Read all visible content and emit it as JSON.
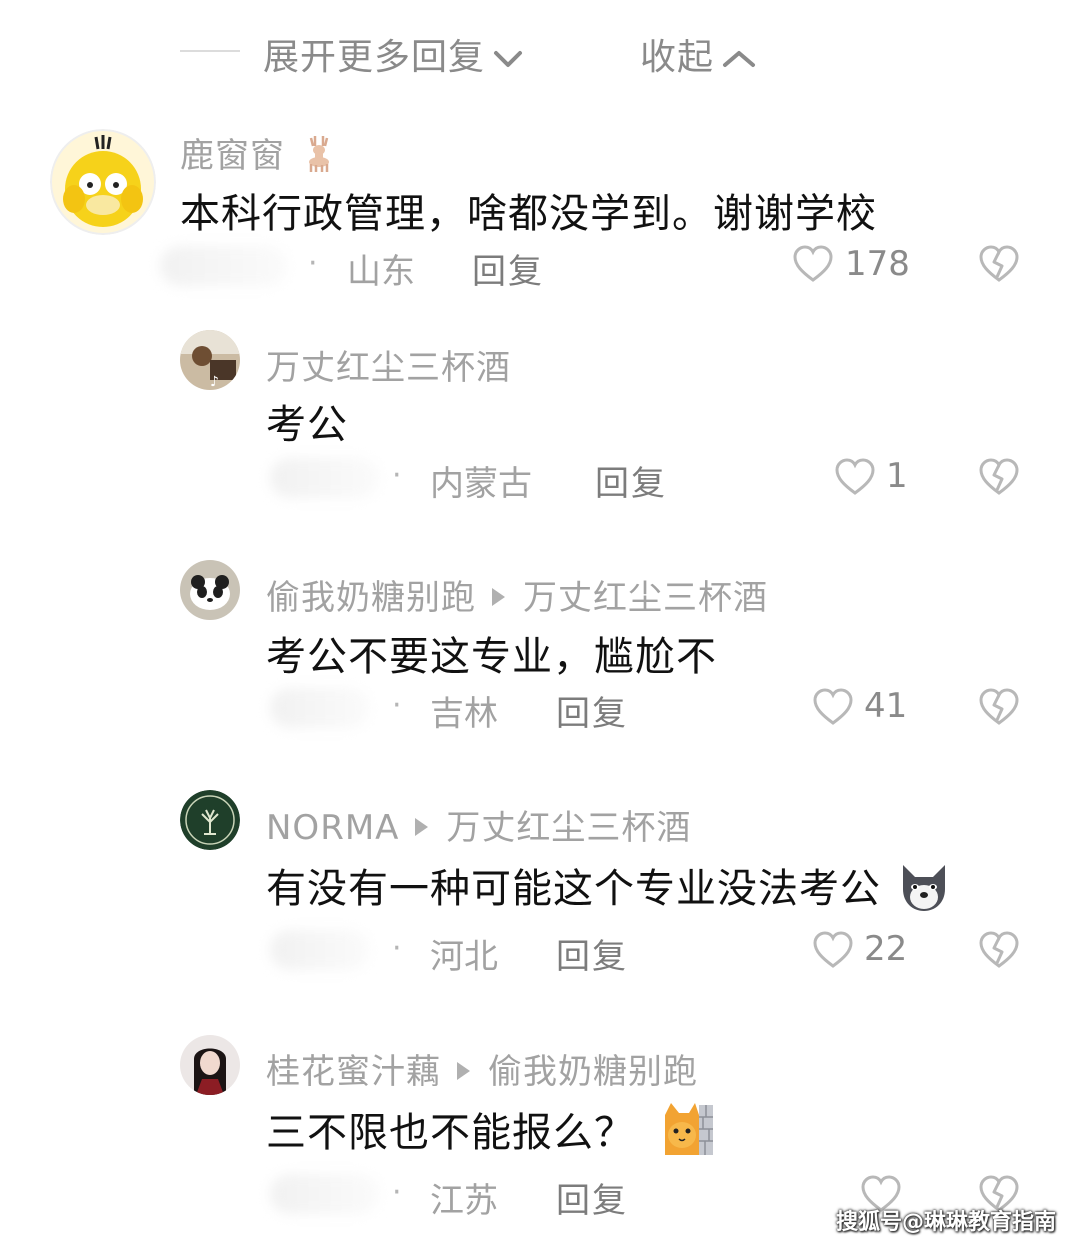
{
  "top": {
    "expand_label": "展开更多回复",
    "collapse_label": "收起"
  },
  "comments": [
    {
      "user": "鹿窗窗",
      "text": "本科行政管理，啥都没学到。谢谢学校",
      "region": "山东",
      "reply": "回复",
      "likes": "178"
    },
    {
      "user": "万丈红尘三杯酒",
      "text": "考公",
      "region": "内蒙古",
      "reply": "回复",
      "likes": "1"
    },
    {
      "user": "偷我奶糖别跑",
      "reply_to": "万丈红尘三杯酒",
      "text": "考公不要这专业，尴尬不",
      "region": "吉林",
      "reply": "回复",
      "likes": "41"
    },
    {
      "user": "NORMA",
      "reply_to": "万丈红尘三杯酒",
      "text": "有没有一种可能这个专业没法考公",
      "region": "河北",
      "reply": "回复",
      "likes": "22"
    },
    {
      "user": "桂花蜜汁藕",
      "reply_to": "偷我奶糖别跑",
      "text": "三不限也不能报么？",
      "region": "江苏",
      "reply": "回复",
      "likes": ""
    }
  ],
  "dot": "·",
  "watermark": "搜狐号@琳琳教育指南",
  "colors": {
    "muted": "#a2a2a2",
    "text": "#111111",
    "heart": "#b8b8b8"
  }
}
